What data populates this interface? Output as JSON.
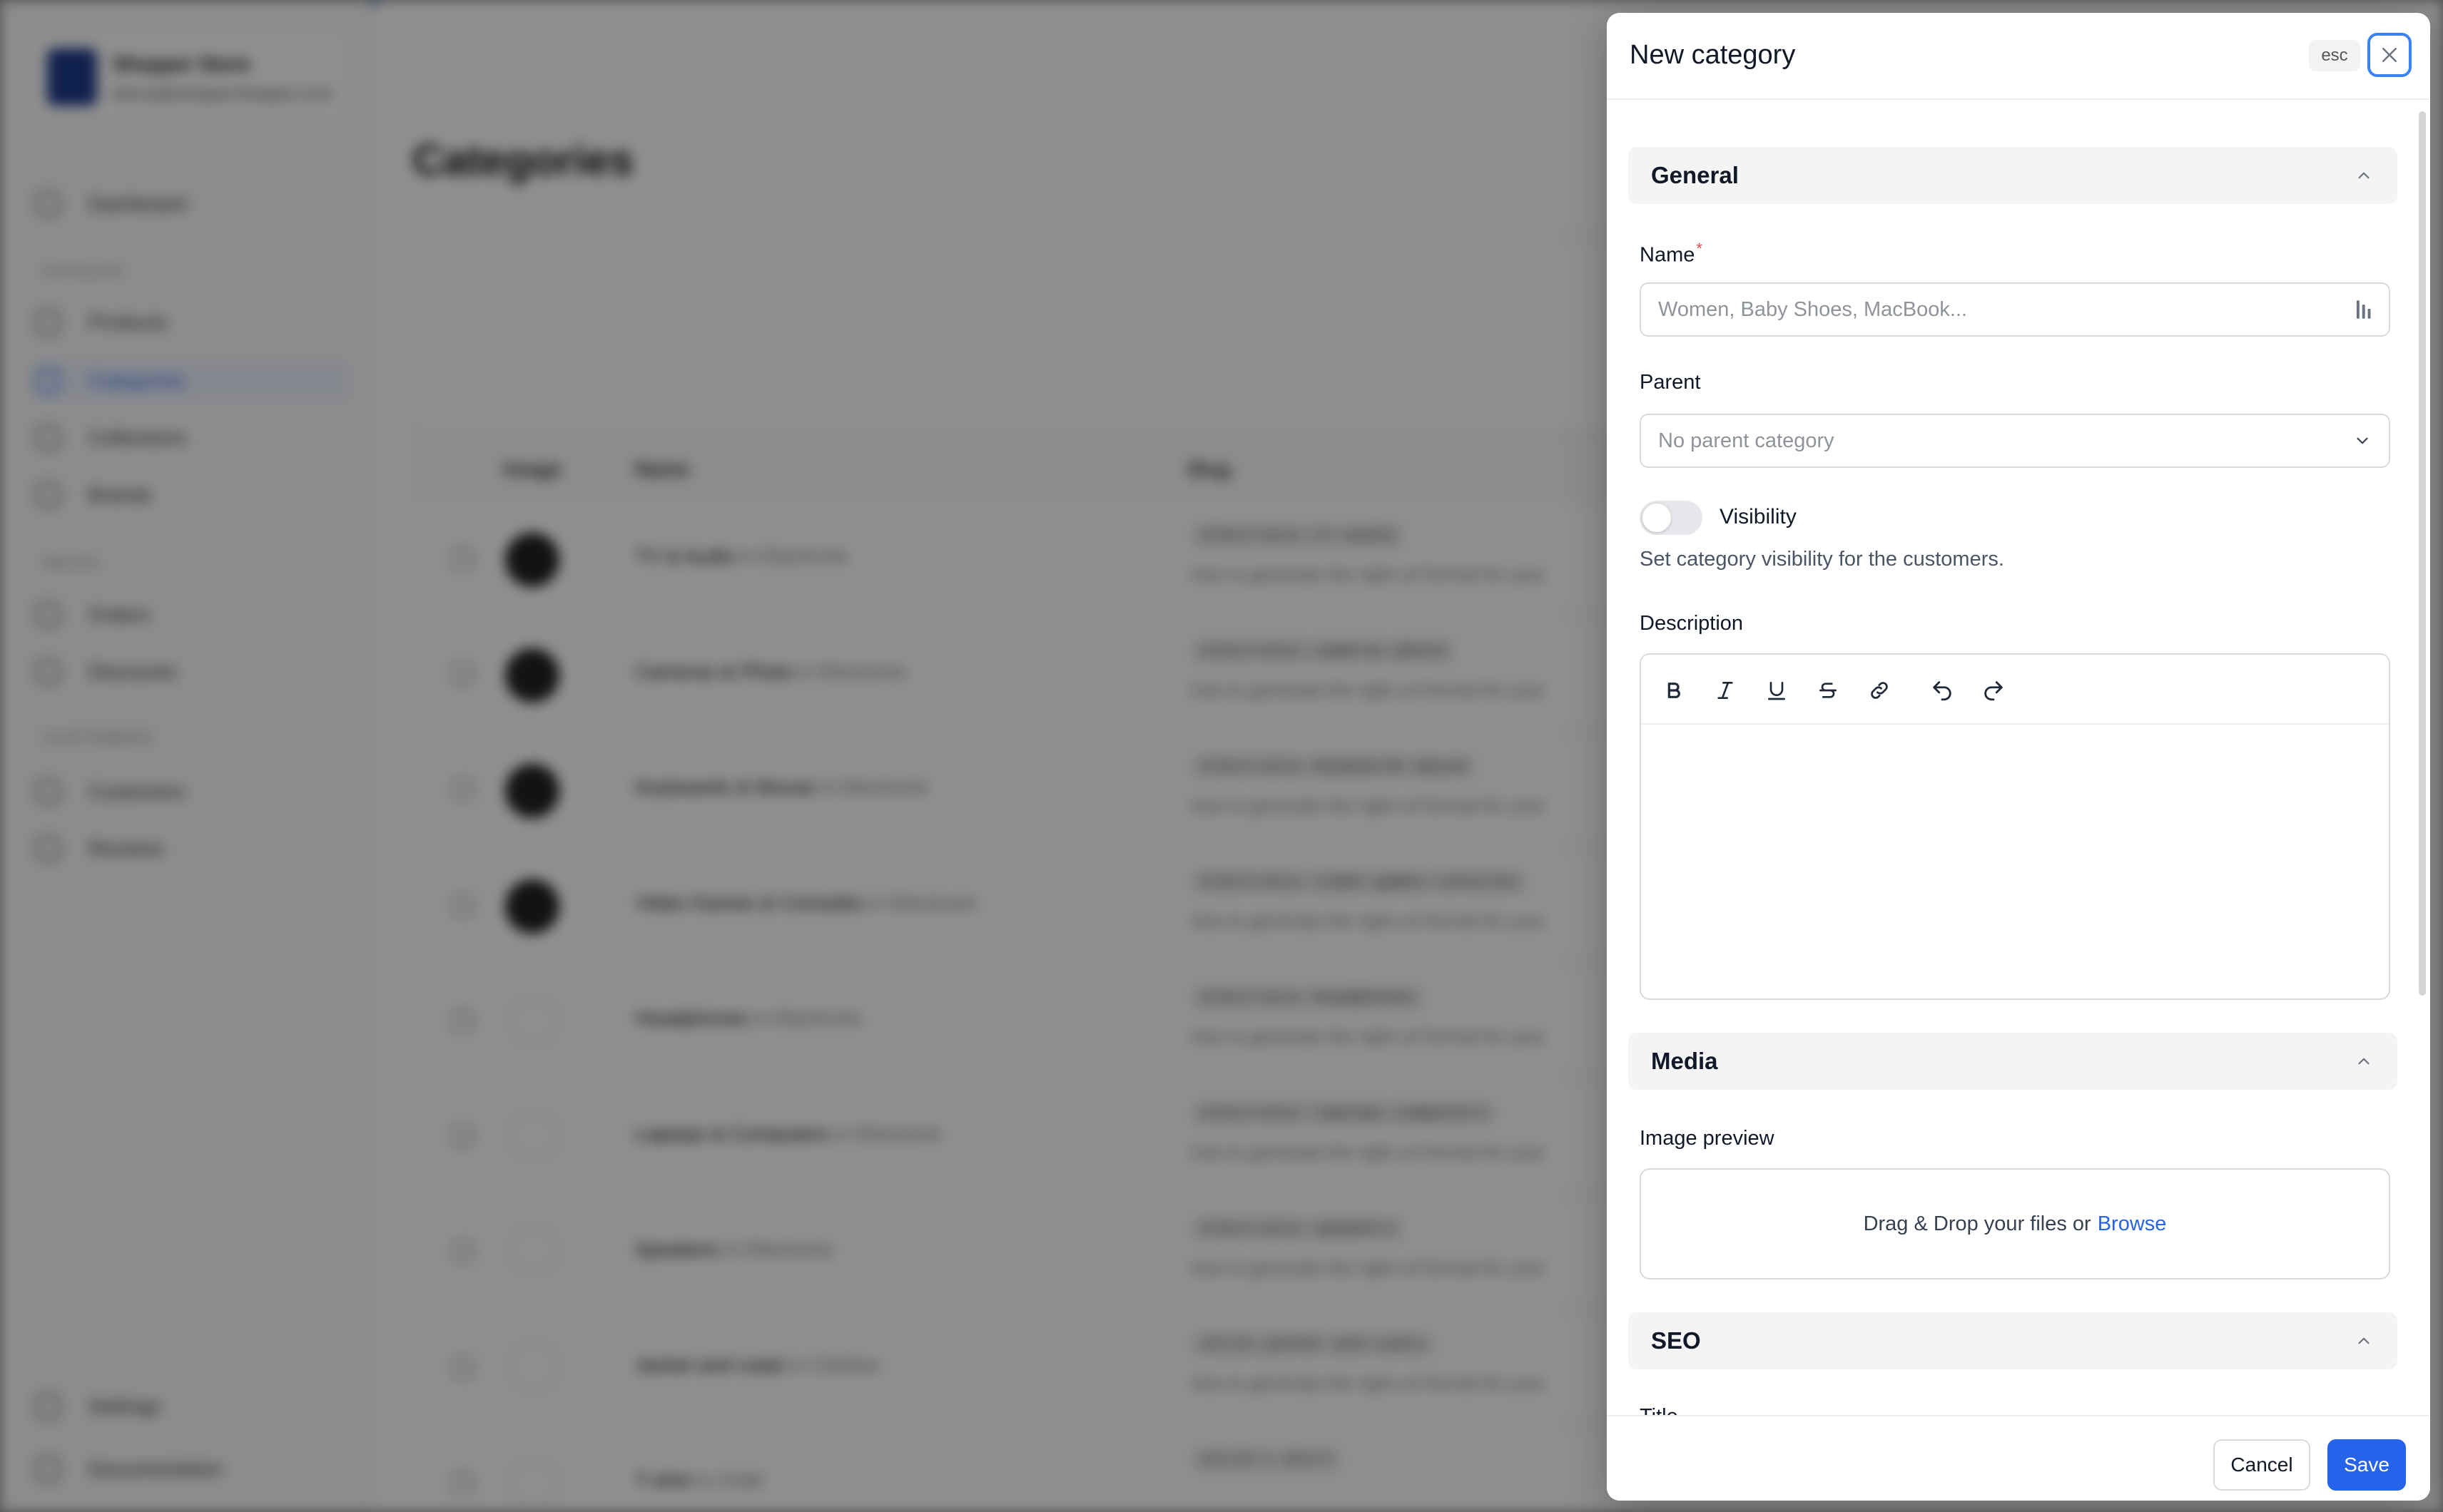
{
  "background": {
    "store": {
      "name": "Shopper Store",
      "email": "demo@shoppershopper.com"
    },
    "page_title": "Categories",
    "nav": {
      "dashboard": "Dashboard",
      "section_catalog": "CATALOG",
      "products": "Products",
      "categories": "Categories",
      "collections": "Collections",
      "brands": "Brands",
      "section_sales": "SALES",
      "orders": "Orders",
      "discounts": "Discounts",
      "section_customers": "CUSTOMERS",
      "customers": "Customers",
      "reviews": "Reviews",
      "settings": "Settings",
      "documentation": "Documentation"
    },
    "table": {
      "columns": [
        "Image",
        "Name",
        "Slug"
      ],
      "rows": [
        {
          "name": "TV & Audio",
          "parent": "in Electronic",
          "slug": "electronic-tv-audio",
          "desc": "Use to generate the right url format for your"
        },
        {
          "name": "Cameras & Photo",
          "parent": "in Electronic",
          "slug": "electronic-cameras-photo",
          "desc": "Use to generate the right url format for your"
        },
        {
          "name": "Keyboards & Mouse",
          "parent": "in Electronic",
          "slug": "electronic-keyboards-mouse",
          "desc": "Use to generate the right url format for your"
        },
        {
          "name": "Video Games & Consoles",
          "parent": "in Electronic",
          "slug": "electronic-video-games-consoles",
          "desc": "Use to generate the right url format for your"
        },
        {
          "name": "Headphones",
          "parent": "in Electronic",
          "slug": "electronic-headphones",
          "desc": "Use to generate the right url format for your"
        },
        {
          "name": "Laptops & Computers",
          "parent": "in Electronic",
          "slug": "electronic-laptops-computers",
          "desc": "Use to generate the right url format for your"
        },
        {
          "name": "Speakers",
          "parent": "in Electronic",
          "slug": "electronic-speakers",
          "desc": "Use to generate the right url format for your"
        },
        {
          "name": "Jacket and coats",
          "parent": "in Clothes",
          "slug": "child-jacket-and-coats",
          "desc": "Use to generate the right url format for your"
        },
        {
          "name": "T-shirt",
          "parent": "in Child",
          "slug": "child-t-shirt",
          "desc": ""
        }
      ]
    }
  },
  "drawer": {
    "title": "New category",
    "esc_label": "esc",
    "general": {
      "section_title": "General",
      "name_label": "Name",
      "name_required_mark": "*",
      "name_value": "",
      "name_placeholder": "Women, Baby Shoes, MacBook...",
      "parent_label": "Parent",
      "parent_value": "No parent category",
      "visibility_label": "Visibility",
      "visibility_on": false,
      "visibility_hint": "Set category visibility for the customers.",
      "description_label": "Description"
    },
    "media": {
      "section_title": "Media",
      "image_preview_label": "Image preview",
      "dropzone_text": "Drag & Drop your files or",
      "browse_label": "Browse"
    },
    "seo": {
      "section_title": "SEO",
      "title_label": "Title"
    },
    "footer": {
      "cancel_label": "Cancel",
      "save_label": "Save"
    }
  },
  "colors": {
    "accent": "#2563eb",
    "required": "#ef4444",
    "overlay": "rgba(0,0,0,0.44)"
  }
}
